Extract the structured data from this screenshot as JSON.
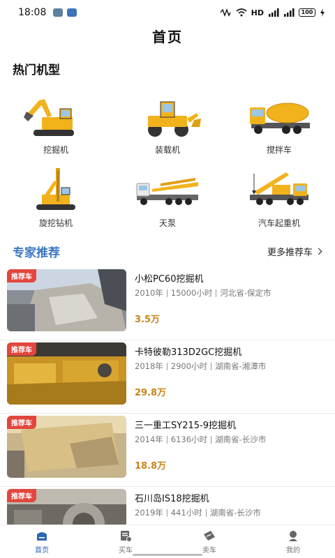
{
  "status_bar": {
    "time": "18:08",
    "network_label": "HD",
    "battery": "100"
  },
  "header": {
    "title": "首页"
  },
  "hot_models": {
    "title": "热门机型",
    "items": [
      {
        "label": "挖掘机",
        "icon": "excavator-icon"
      },
      {
        "label": "装载机",
        "icon": "loader-icon"
      },
      {
        "label": "搅拌车",
        "icon": "mixer-truck-icon"
      },
      {
        "label": "旋挖钻机",
        "icon": "rotary-drill-icon"
      },
      {
        "label": "天泵",
        "icon": "pump-truck-icon"
      },
      {
        "label": "汽车起重机",
        "icon": "truck-crane-icon"
      }
    ]
  },
  "expert": {
    "title": "专家推荐",
    "more_label": "更多推荐车"
  },
  "listings": [
    {
      "badge": "推荐车",
      "name": "小松PC60挖掘机",
      "year": "2010年",
      "hours": "15000小时",
      "location": "河北省-保定市",
      "price": "3.5万"
    },
    {
      "badge": "推荐车",
      "name": "卡特彼勒313D2GC挖掘机",
      "year": "2018年",
      "hours": "2900小时",
      "location": "湖南省-湘潭市",
      "price": "29.8万"
    },
    {
      "badge": "推荐车",
      "name": "三一重工SY215-9挖掘机",
      "year": "2014年",
      "hours": "6136小时",
      "location": "湖南省-长沙市",
      "price": "18.8万"
    },
    {
      "badge": "推荐车",
      "name": "石川岛IS18挖掘机",
      "year": "2019年",
      "hours": "441小时",
      "location": "湖南省-长沙市",
      "price": ""
    }
  ],
  "tabbar": {
    "items": [
      {
        "label": "首页",
        "icon": "home-icon",
        "active": true
      },
      {
        "label": "买车",
        "icon": "buy-icon",
        "active": false
      },
      {
        "label": "卖车",
        "icon": "sell-icon",
        "active": false
      },
      {
        "label": "我的",
        "icon": "profile-icon",
        "active": false
      }
    ]
  },
  "colors": {
    "accent": "#3a77c2",
    "price": "#c9831c",
    "badge": "#e2463d",
    "machine_yellow": "#f2b21c"
  }
}
